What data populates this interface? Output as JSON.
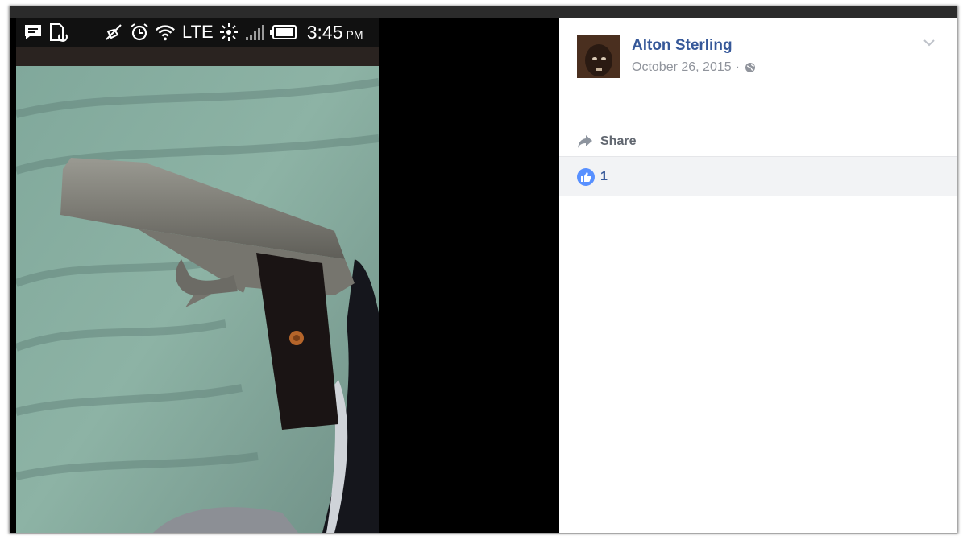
{
  "status_bar": {
    "network": "LTE",
    "time": "3:45",
    "ampm": "PM",
    "icons": [
      "message-icon",
      "sd-card-sync-icon",
      "mute-icon",
      "alarm-icon",
      "wifi-icon",
      "brightness-icon",
      "signal-icon",
      "battery-icon"
    ]
  },
  "post": {
    "author": "Alton Sterling",
    "date": "October 26, 2015",
    "separator": "·",
    "privacy_icon": "globe-icon",
    "share_label": "Share",
    "like_count": "1"
  },
  "colors": {
    "link_blue": "#365899",
    "meta_gray": "#90949c",
    "like_blue": "#5890ff",
    "reaction_bar": "#f2f3f5"
  }
}
